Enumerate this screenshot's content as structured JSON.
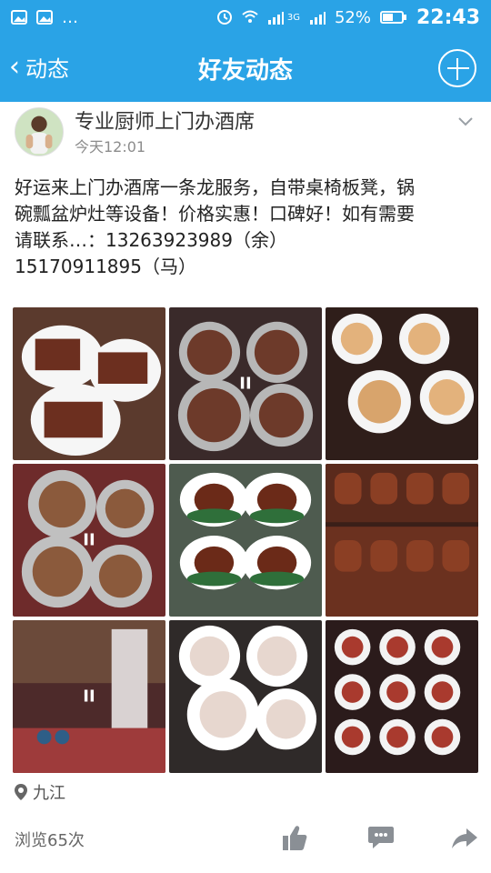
{
  "status": {
    "battery": "52%",
    "time": "22:43",
    "network": "3G"
  },
  "nav": {
    "back_label": "动态",
    "title": "好友动态"
  },
  "post": {
    "author": "专业厨师上门办酒席",
    "time": "今天12:01",
    "content_lines": [
      "好运来上门办酒席一条龙服务，自带桌椅板凳，锅",
      "碗瓢盆炉灶等设备！价格实惠！口碑好！如有需要",
      "请联系…：13263923989（余）",
      "15170911895（马）"
    ],
    "location": "九江",
    "views": "浏览65次"
  },
  "colors": {
    "header": "#2aa3e6",
    "text": "#222222",
    "muted": "#8c8c8c"
  }
}
